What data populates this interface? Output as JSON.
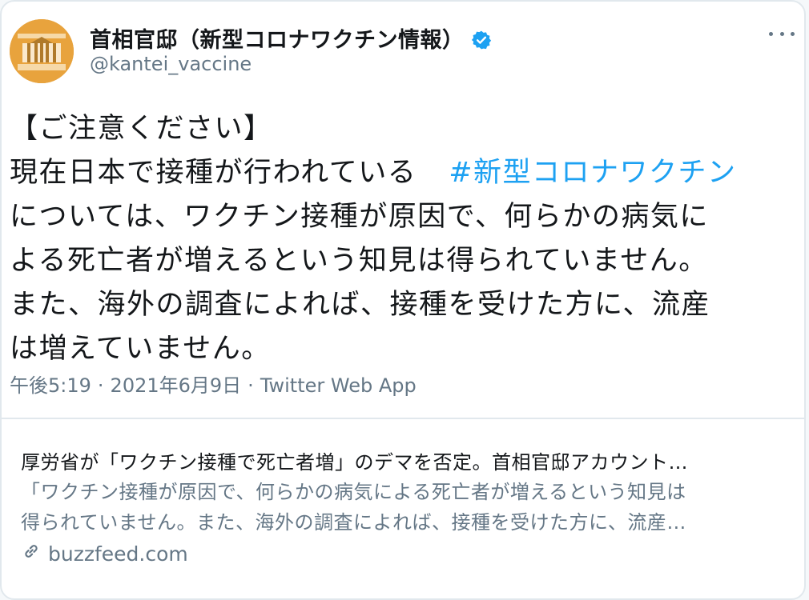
{
  "account": {
    "display_name": "首相官邸（新型コロナワクチン情報）",
    "handle": "@kantei_vaccine",
    "verified": true,
    "avatar_icon": "kantei-building-logo-icon"
  },
  "menu": {
    "icon": "more-dots-icon"
  },
  "tweet": {
    "lines": [
      "【ご注意ください】",
      "現在日本で接種が行われている",
      "については、ワクチン接種が原因で、何らかの病気に",
      "よる死亡者が増えるという知見は得られていません。",
      "また、海外の調査によれば、接種を受けた方に、流産",
      "は増えていません。"
    ],
    "hashtag": "#新型コロナワクチン",
    "time": "午後5:19",
    "date": "2021年6月9日",
    "source": "Twitter Web App",
    "separator": "·"
  },
  "link_card": {
    "title": "厚労省が「ワクチン接種で死亡者増」のデマを否定。首相官邸アカウント…",
    "description_lines": [
      "「ワクチン接種が原因で、何らかの病気による死亡者が増えるという知見は",
      "得られていません。また、海外の調査によれば、接種を受けた方に、流産…"
    ],
    "domain": "buzzfeed.com",
    "icon": "link-icon"
  },
  "colors": {
    "accent": "#1da1f2",
    "text_primary": "#14171a",
    "text_secondary": "#657786",
    "border": "#e1e8ed",
    "avatar_bg": "#e8a33d"
  }
}
